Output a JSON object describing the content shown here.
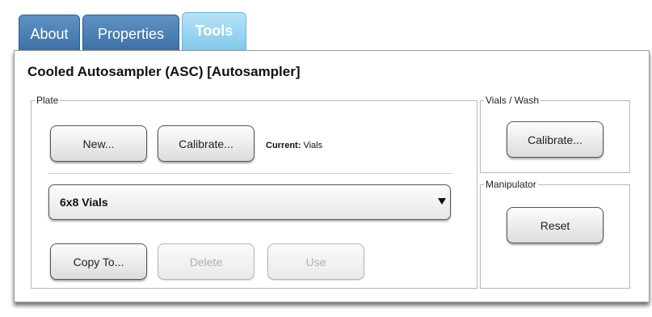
{
  "tabs": [
    {
      "label": "About",
      "active": false
    },
    {
      "label": "Properties",
      "active": false
    },
    {
      "label": "Tools",
      "active": true
    }
  ],
  "panel": {
    "title": "Cooled Autosampler (ASC) [Autosampler]",
    "plate": {
      "legend": "Plate",
      "new_label": "New...",
      "calibrate_label": "Calibrate...",
      "current_prefix": "Current:",
      "current_value": "Vials",
      "selected_plate": "6x8 Vials",
      "copy_to_label": "Copy To...",
      "delete_label": "Delete",
      "use_label": "Use"
    },
    "vials_wash": {
      "legend": "Vials / Wash",
      "calibrate_label": "Calibrate..."
    },
    "manipulator": {
      "legend": "Manipulator",
      "reset_label": "Reset"
    }
  },
  "colors": {
    "tab_inactive": "#4a7eb3",
    "tab_active": "#9fd7f2"
  }
}
